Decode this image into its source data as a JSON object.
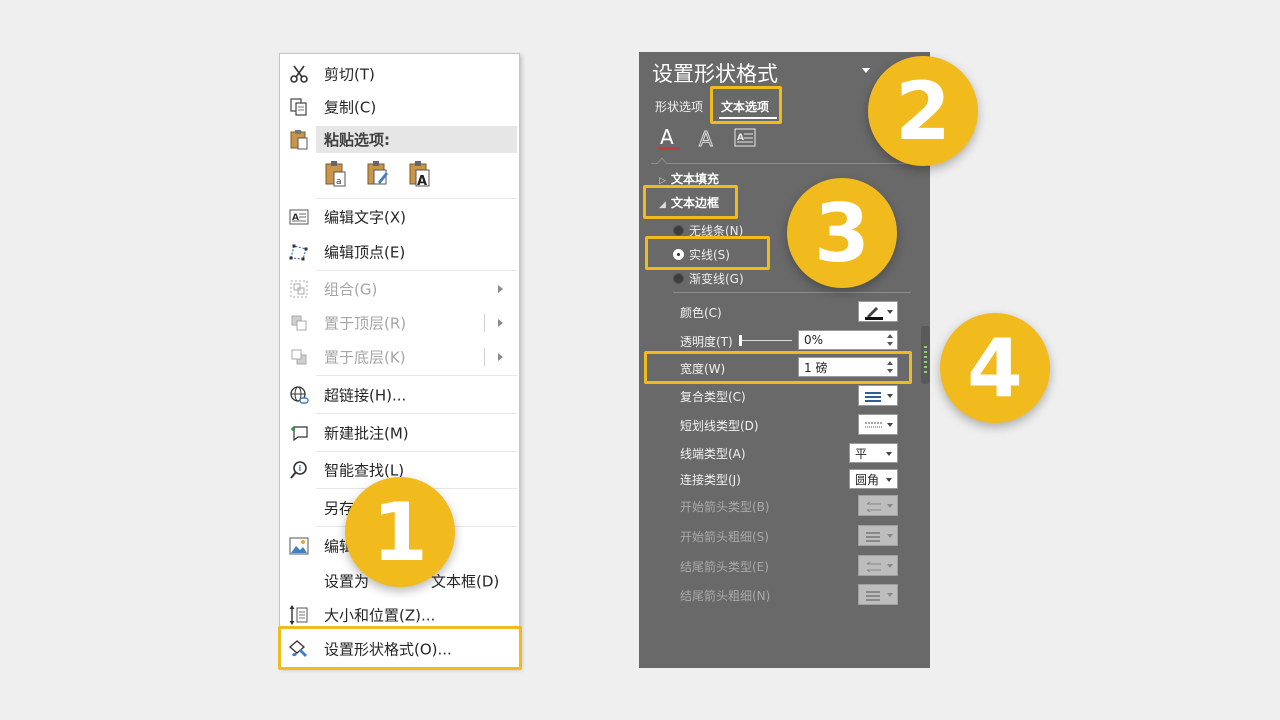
{
  "context_menu": {
    "items": [
      {
        "id": "cut",
        "label": "剪切(T)",
        "icon": "scissors-icon"
      },
      {
        "id": "copy",
        "label": "复制(C)",
        "icon": "copy-icon"
      },
      {
        "id": "paste_options",
        "label": "粘贴选项:",
        "icon": "clipboard-icon"
      },
      {
        "id": "edit_text",
        "label": "编辑文字(X)",
        "icon": "edit-text-icon"
      },
      {
        "id": "edit_points",
        "label": "编辑顶点(E)",
        "icon": "edit-points-icon"
      },
      {
        "id": "group",
        "label": "组合(G)",
        "icon": "group-icon",
        "disabled": true
      },
      {
        "id": "bring_front",
        "label": "置于顶层(R)",
        "icon": "bring-front-icon",
        "disabled": true
      },
      {
        "id": "send_back",
        "label": "置于底层(K)",
        "icon": "send-back-icon",
        "disabled": true
      },
      {
        "id": "hyperlink",
        "label": "超链接(H)...",
        "icon": "globe-link-icon"
      },
      {
        "id": "new_comment",
        "label": "新建批注(M)",
        "icon": "comment-icon"
      },
      {
        "id": "smart_lookup",
        "label": "智能查找(L)",
        "icon": "smart-lookup-icon"
      },
      {
        "id": "save_as",
        "label": "另存",
        "icon": ""
      },
      {
        "id": "edit_alt",
        "label": "编辑",
        "tail": "...",
        "icon": "picture-icon"
      },
      {
        "id": "set_default",
        "label": "设置为",
        "tail": "文本框(D)",
        "icon": ""
      },
      {
        "id": "size_pos",
        "label": "大小和位置(Z)...",
        "icon": "size-position-icon"
      },
      {
        "id": "format_shape",
        "label": "设置形状格式(O)...",
        "icon": "format-shape-icon"
      }
    ]
  },
  "format_pane": {
    "title": "设置形状格式",
    "tabs": [
      "形状选项",
      "文本选项"
    ],
    "active_tab": "文本选项",
    "sections": {
      "text_fill": "文本填充",
      "text_outline": "文本边框"
    },
    "outline_options": [
      "无线条(N)",
      "实线(S)",
      "渐变线(G)"
    ],
    "selected_outline": "实线(S)",
    "properties": {
      "color": "颜色(C)",
      "transparency": "透明度(T)",
      "transparency_value": "0%",
      "width": "宽度(W)",
      "width_value": "1 磅",
      "compound": "复合类型(C)",
      "dash": "短划线类型(D)",
      "cap": "线端类型(A)",
      "cap_value": "平",
      "join": "连接类型(J)",
      "join_value": "圆角",
      "begin_arrow_type": "开始箭头类型(B)",
      "begin_arrow_size": "开始箭头粗细(S)",
      "end_arrow_type": "结尾箭头类型(E)",
      "end_arrow_size": "结尾箭头粗细(N)"
    }
  },
  "steps": [
    "1",
    "2",
    "3",
    "4"
  ],
  "colors": {
    "highlight": "#f2bb1d",
    "pane_bg": "#696969",
    "menu_bg": "#ffffff",
    "page_bg": "#efefef"
  }
}
